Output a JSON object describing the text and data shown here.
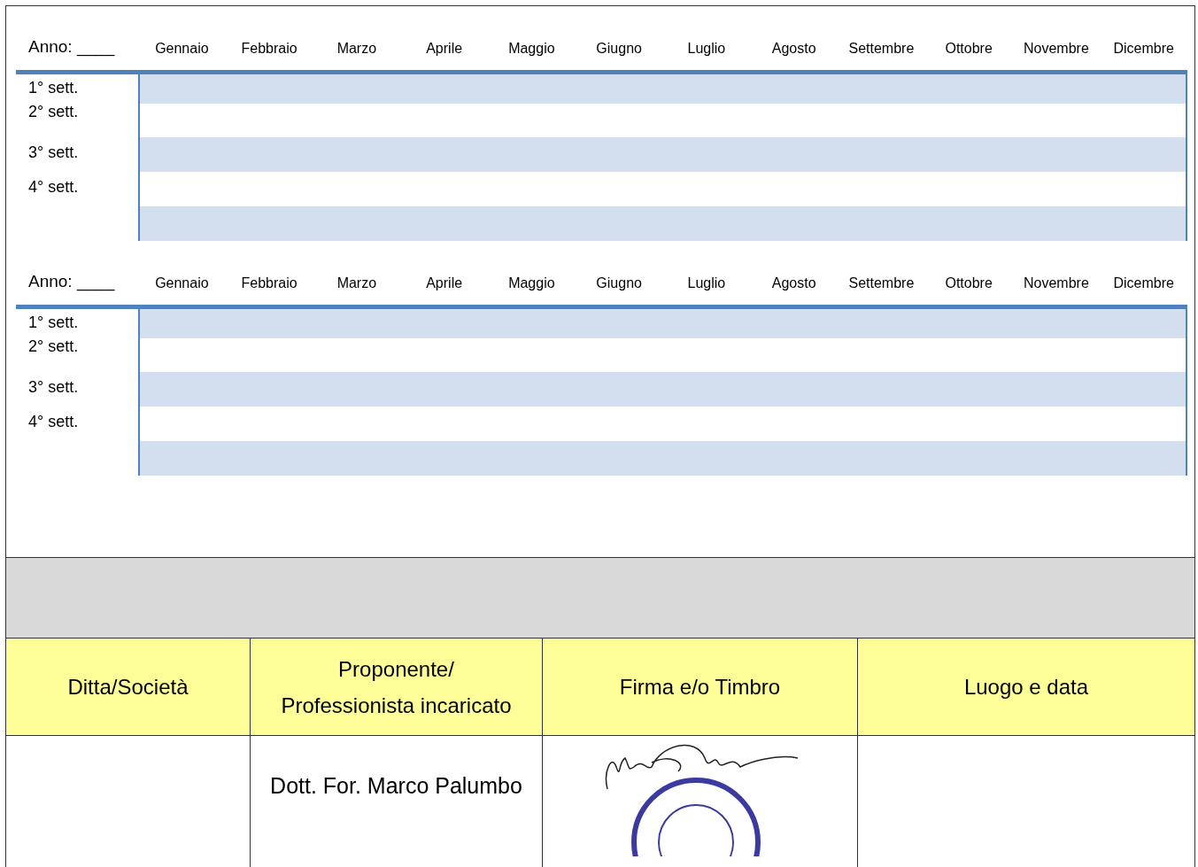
{
  "calendars": [
    {
      "year_label": "Anno: ____",
      "months": [
        "Gennaio",
        "Febbraio",
        "Marzo",
        "Aprile",
        "Maggio",
        "Giugno",
        "Luglio",
        "Agosto",
        "Settembre",
        "Ottobre",
        "Novembre",
        "Dicembre"
      ],
      "weeks": [
        "1° sett.",
        "2° sett.",
        "3° sett.",
        "4° sett."
      ]
    },
    {
      "year_label": "Anno: ____",
      "months": [
        "Gennaio",
        "Febbraio",
        "Marzo",
        "Aprile",
        "Maggio",
        "Giugno",
        "Luglio",
        "Agosto",
        "Settembre",
        "Ottobre",
        "Novembre",
        "Dicembre"
      ],
      "weeks": [
        "1° sett.",
        "2° sett.",
        "3° sett.",
        "4° sett."
      ]
    }
  ],
  "signature_table": {
    "columns": [
      "Ditta/Società",
      "Proponente/\nProfessionista incaricato",
      "Firma e/o Timbro",
      "Luogo e data"
    ],
    "row": {
      "proponente": "Dott. For. Marco Palumbo"
    }
  }
}
